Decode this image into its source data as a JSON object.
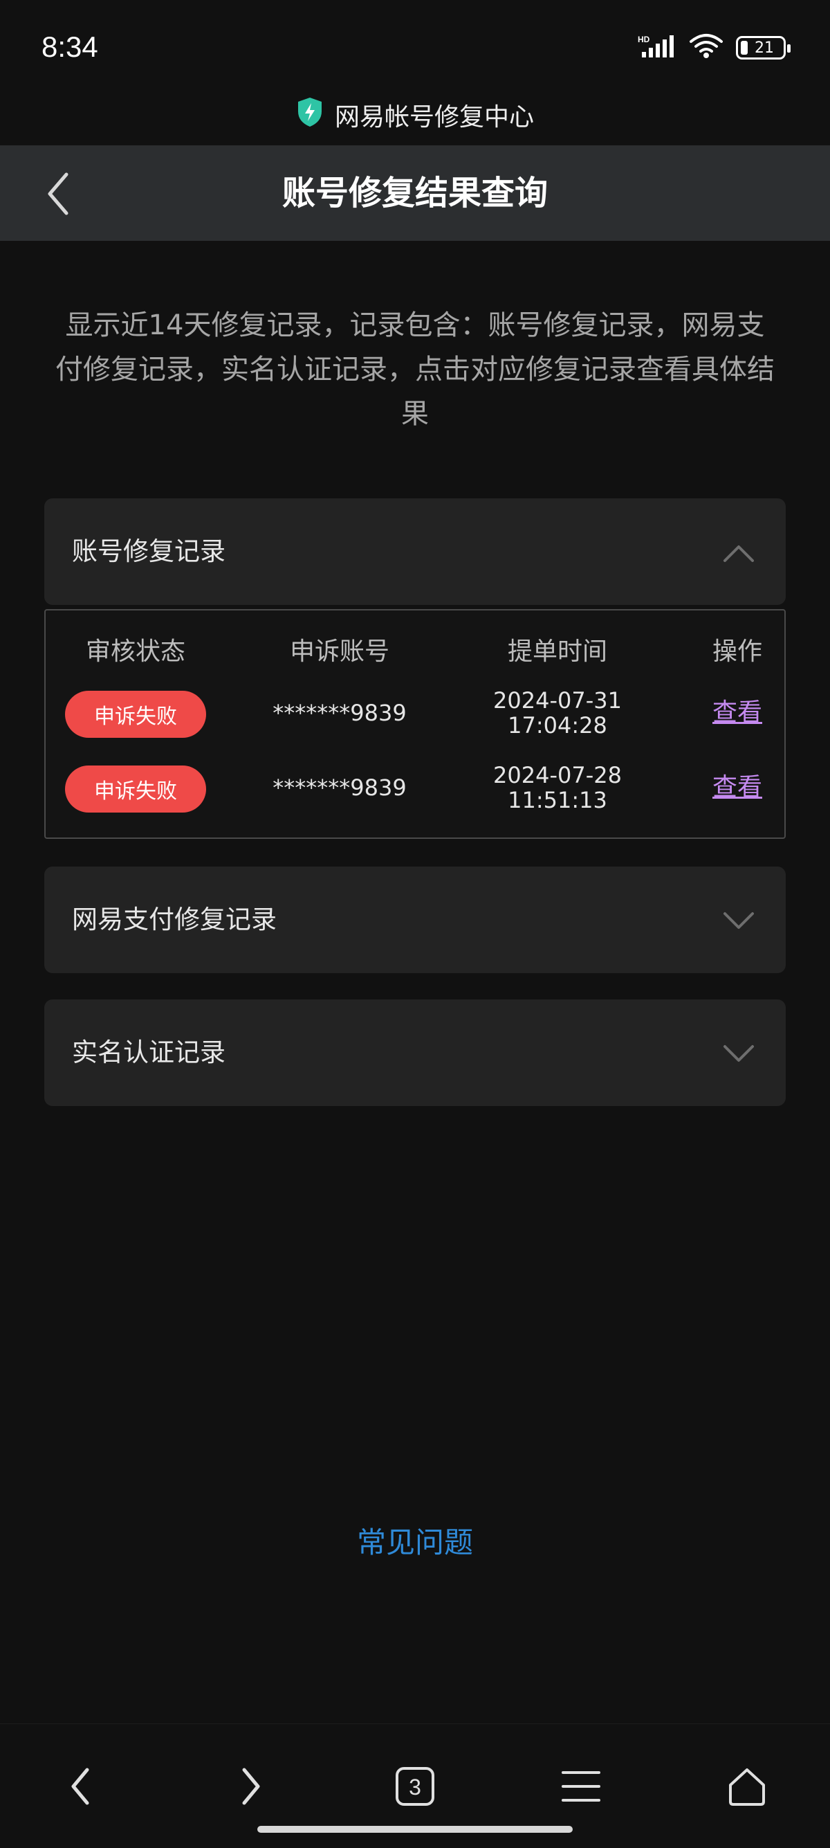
{
  "status_bar": {
    "time": "8:34",
    "battery": "21",
    "network_label": "HD",
    "icons": [
      "signal-icon",
      "wifi-icon",
      "battery-icon"
    ]
  },
  "site": {
    "title": "网易帐号修复中心",
    "icon": "shield-bolt-icon",
    "icon_color": "#2ec4a5"
  },
  "nav": {
    "title": "账号修复结果查询",
    "back_icon": "chevron-left-icon"
  },
  "description": "显示近14天修复记录，记录包含：账号修复记录，网易支付修复记录，实名认证记录，点击对应修复记录查看具体结果",
  "sections": [
    {
      "label": "账号修复记录",
      "expanded": true,
      "icon": "chevron-up-icon"
    },
    {
      "label": "网易支付修复记录",
      "expanded": false,
      "icon": "chevron-down-icon"
    },
    {
      "label": "实名认证记录",
      "expanded": false,
      "icon": "chevron-down-icon"
    }
  ],
  "records_table": {
    "headers": [
      "审核状态",
      "申诉账号",
      "提单时间",
      "操作"
    ],
    "rows": [
      {
        "status": "申诉失败",
        "account": "*******9839",
        "time_line1": "2024-07-31",
        "time_line2": "17:04:28",
        "action": "查看"
      },
      {
        "status": "申诉失败",
        "account": "*******9839",
        "time_line1": "2024-07-28 11:51:13",
        "time_line2": "",
        "action": "查看"
      }
    ]
  },
  "faq_label": "常见问题",
  "bottom_nav": {
    "tab_count": "3",
    "icons": [
      "back-arrow-icon",
      "forward-arrow-icon",
      "tabs-icon",
      "menu-icon",
      "home-icon"
    ]
  },
  "colors": {
    "background": "#111111",
    "nav_bar": "#2c2e30",
    "panel": "#232323",
    "badge_red": "#ef4a48",
    "link_purple": "#c58af0",
    "faq_blue": "#2f8ad8"
  }
}
